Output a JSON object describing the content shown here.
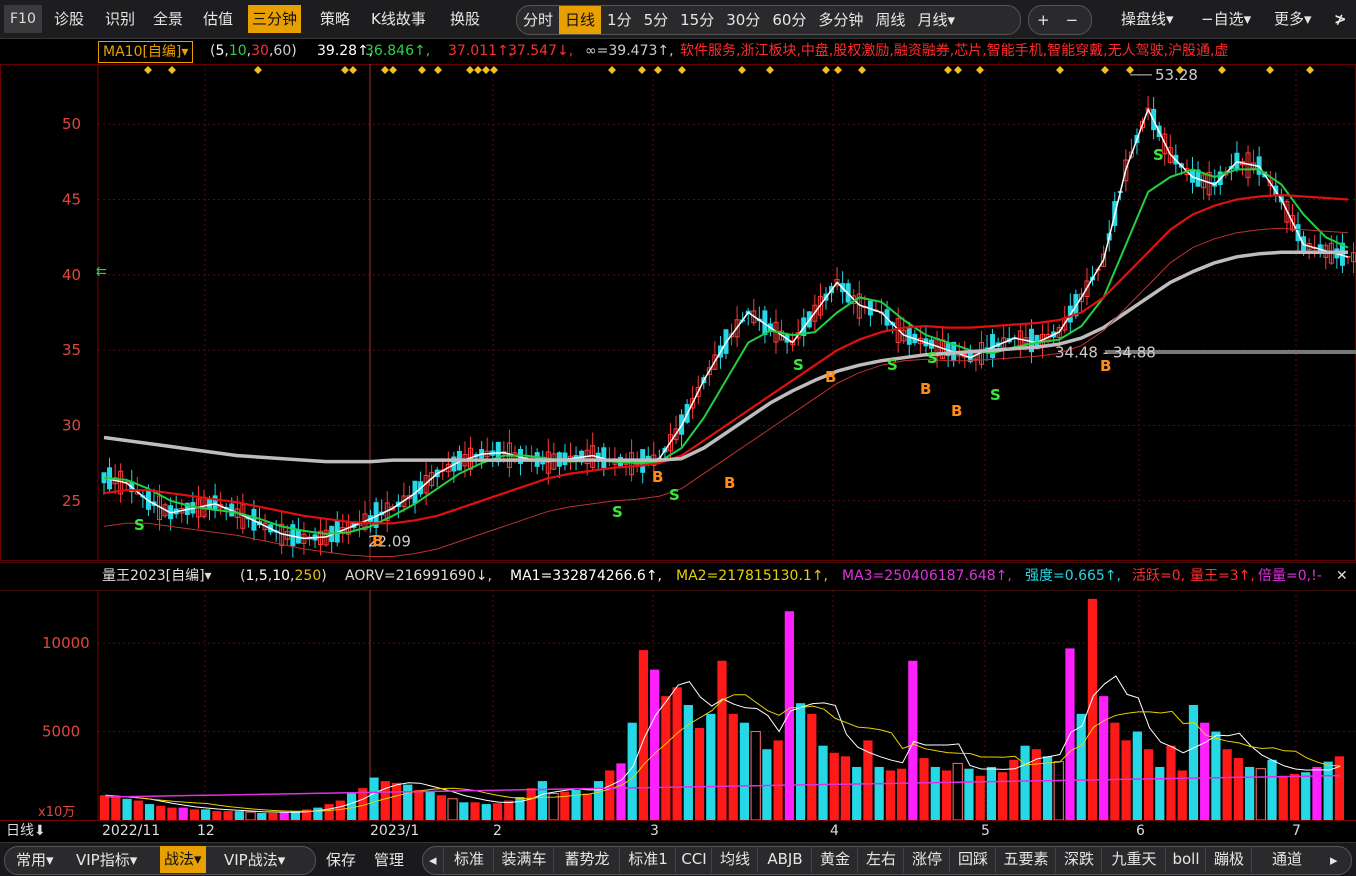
{
  "toolbar": {
    "f10": "F10",
    "left_items": [
      "诊股",
      "识别",
      "全景",
      "估值",
      "三分钟",
      "策略",
      "K线故事",
      "换股"
    ],
    "period_items": [
      "分时",
      "日线",
      "1分",
      "5分",
      "15分",
      "30分",
      "60分",
      "多分钟",
      "周线",
      "月线▾"
    ],
    "zoom_in": "+",
    "zoom_out": "−",
    "right_items": [
      "操盘线▾",
      "−自选▾",
      "更多▾"
    ],
    "collapse": "≯",
    "active_left": "三分钟",
    "active_period": "日线"
  },
  "ma_line": {
    "tag": "MA10[自编]▾",
    "params": "(5,10,30,60)",
    "v1": "39.28↑,",
    "v2": "36.846↑,",
    "v3": "37.011↑,",
    "v4": "37.547↓,",
    "v5": "∞=39.473↑,",
    "concepts": "软件服务,浙江板块,中盘,股权激励,融资融券,芯片,智能手机,智能穿戴,无人驾驶,沪股通,虚"
  },
  "price_axis": [
    "50",
    "45",
    "40",
    "35",
    "30",
    "25"
  ],
  "annotations": {
    "high": "53.28",
    "low": "22.09",
    "level_left": "34.48",
    "level_right": "34.88"
  },
  "volume_header": {
    "name": "量王2023[自编]▾",
    "params": "(1,5,10,250)",
    "aorv": "AORV=216991690↓,",
    "ma1": "MA1=332874266.6↑,",
    "ma2": "MA2=217815130.1↑,",
    "ma3": "MA3=250406187.648↑,",
    "strength": "强度=0.665↑,",
    "active": "活跃=0,",
    "king": "量王=3↑,",
    "ratio": "倍量=0,!-"
  },
  "volume_axis": [
    "10000",
    "5000"
  ],
  "volume_unit": "x10万",
  "xaxis": {
    "period": "日线⬇",
    "labels": [
      "2022/11",
      "12",
      "2023/1",
      "2",
      "3",
      "4",
      "5",
      "6",
      "7"
    ]
  },
  "bottom": {
    "left_groups": [
      "常用▾",
      "VIP指标▾",
      "战法▾",
      "VIP战法▾"
    ],
    "active_group": "战法▾",
    "save": "保存",
    "manage": "管理",
    "nav_left": "◂",
    "tabs": [
      "标准",
      "装满车",
      "蓄势龙",
      "标准1",
      "CCI",
      "均线",
      "ABJB",
      "黄金",
      "左右",
      "涨停",
      "回踩",
      "五要素",
      "深跌",
      "九重天",
      "boll",
      "蹦极",
      "通道"
    ],
    "nav_right": "▸"
  },
  "colors": {
    "up": "#ff2020",
    "down": "#26d7e6",
    "ma5": "#ffffff",
    "ma10": "#20d040",
    "ma30": "#e01010",
    "ma60": "#bdbdbd",
    "accent": "#e8a000",
    "signal_s": "#38e838",
    "signal_b": "#ff8c1a"
  },
  "chart_data": {
    "type": "candlestick",
    "x_labels": [
      "2022/11",
      "12",
      "2023/1",
      "2",
      "3",
      "4",
      "5",
      "6",
      "7"
    ],
    "ylim": [
      21,
      54
    ],
    "price_ticks": [
      25,
      30,
      35,
      40,
      45,
      50
    ],
    "volume_ylim": [
      0,
      13000
    ],
    "volume_ticks": [
      5000,
      10000
    ],
    "series": [
      {
        "name": "MA5",
        "values": [
          26.5,
          26.2,
          25.0,
          24.2,
          24.5,
          24.8,
          24.2,
          23.5,
          22.8,
          22.5,
          22.6,
          23.2,
          23.8,
          24.5,
          25.5,
          26.8,
          27.6,
          28.1,
          28.2,
          27.8,
          27.6,
          27.8,
          28.0,
          27.6,
          27.5,
          27.8,
          30.0,
          33.0,
          35.5,
          37.5,
          36.5,
          35.5,
          37.5,
          39.5,
          38.0,
          37.5,
          36.0,
          35.5,
          35.0,
          34.5,
          35.2,
          35.8,
          35.5,
          36.2,
          38.5,
          41.0,
          47.0,
          51.0,
          48.0,
          46.5,
          46.0,
          47.5,
          47.2,
          45.0,
          42.0,
          41.6,
          41.2
        ]
      },
      {
        "name": "MA10",
        "values": [
          26.5,
          26.4,
          25.8,
          25.0,
          24.6,
          24.4,
          24.2,
          23.8,
          23.3,
          23.0,
          22.8,
          22.9,
          23.3,
          24.0,
          24.8,
          25.8,
          26.8,
          27.5,
          28.0,
          28.0,
          27.8,
          27.6,
          27.7,
          27.6,
          27.5,
          27.6,
          28.5,
          30.5,
          33.0,
          35.5,
          36.3,
          36.0,
          36.2,
          37.5,
          38.5,
          38.2,
          37.0,
          36.0,
          35.5,
          35.0,
          34.8,
          35.2,
          35.5,
          35.7,
          36.6,
          38.5,
          42.0,
          45.5,
          46.5,
          47.0,
          46.5,
          47.0,
          47.0,
          46.0,
          44.0,
          42.5,
          41.8
        ]
      },
      {
        "name": "MA30",
        "values": [
          25.5,
          25.7,
          25.7,
          25.5,
          25.3,
          25.1,
          24.9,
          24.6,
          24.3,
          24.0,
          23.8,
          23.6,
          23.5,
          23.5,
          23.7,
          24.0,
          24.5,
          25.0,
          25.5,
          26.0,
          26.5,
          26.8,
          27.0,
          27.2,
          27.3,
          27.5,
          28.0,
          29.0,
          30.0,
          31.0,
          32.0,
          33.0,
          34.0,
          35.0,
          35.7,
          36.2,
          36.5,
          36.6,
          36.5,
          36.5,
          36.6,
          36.7,
          36.8,
          37.0,
          37.5,
          38.5,
          40.0,
          41.5,
          43.0,
          44.0,
          44.6,
          45.0,
          45.2,
          45.3,
          45.2,
          45.1,
          45.0
        ]
      },
      {
        "name": "MA60",
        "values": [
          29.2,
          29.0,
          28.8,
          28.6,
          28.4,
          28.2,
          28.0,
          27.9,
          27.8,
          27.7,
          27.6,
          27.6,
          27.6,
          27.7,
          27.7,
          27.7,
          27.7,
          27.7,
          27.7,
          27.7,
          27.7,
          27.7,
          27.7,
          27.7,
          27.7,
          27.7,
          27.8,
          28.5,
          29.5,
          30.5,
          31.5,
          32.3,
          33.0,
          33.6,
          34.0,
          34.3,
          34.5,
          34.7,
          34.8,
          34.9,
          35.0,
          35.1,
          35.2,
          35.4,
          35.8,
          36.5,
          37.5,
          38.5,
          39.5,
          40.2,
          40.8,
          41.2,
          41.4,
          41.5,
          41.5,
          41.5,
          41.5
        ]
      }
    ],
    "high": 53.28,
    "low": 22.09,
    "support_level": 34.88,
    "marker_lines": [
      {
        "name": "MA5",
        "color": "#ffffff"
      },
      {
        "name": "MA10",
        "color": "#20d040"
      },
      {
        "name": "MA30",
        "color": "#e01010"
      },
      {
        "name": "MA60",
        "color": "#bdbdbd"
      }
    ]
  }
}
